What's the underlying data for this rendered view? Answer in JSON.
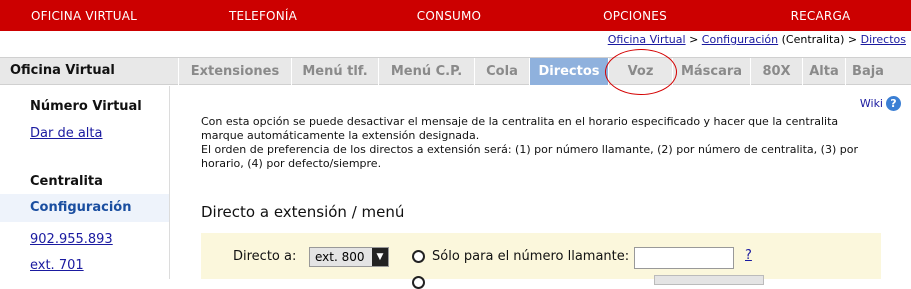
{
  "topnav": {
    "items": [
      {
        "label": "OFICINA VIRTUAL"
      },
      {
        "label": "TELEFONÍA"
      },
      {
        "label": "CONSUMO"
      },
      {
        "label": "OPCIONES"
      },
      {
        "label": "RECARGA"
      }
    ],
    "color": "#cc0000"
  },
  "breadcrumb": {
    "link1": "Oficina Virtual",
    "sep1": " > ",
    "link2": "Configuración",
    "plain": " (Centralita) > ",
    "link3": "Directos"
  },
  "tabrow": {
    "title": "Oficina Virtual",
    "tabs": [
      {
        "label": "Extensiones"
      },
      {
        "label": "Menú tlf."
      },
      {
        "label": "Menú C.P."
      },
      {
        "label": "Cola"
      },
      {
        "label": "Directos"
      },
      {
        "label": "Voz"
      },
      {
        "label": "Máscara"
      },
      {
        "label": "80X"
      },
      {
        "label": "Alta"
      },
      {
        "label": "Baja"
      }
    ],
    "active_tab": "Directos",
    "active_color": "#8fb1dd"
  },
  "sidebar": {
    "heading1": "Número Virtual",
    "link_alta": "Dar de alta",
    "heading2": "Centralita",
    "active_item": "Configuración",
    "link_number": "902.955.893",
    "link_ext": "ext. 701"
  },
  "main": {
    "wiki_label": "Wiki",
    "help_icon": "question-circle-icon",
    "description_line1": "Con esta opción se puede desactivar el mensaje de la centralita en el horario especificado y hacer que la centralita",
    "description_line2": "marque automáticamente la extensión designada.",
    "description_line3": "El orden de preferencia de los directos a extensión será: (1) por número llamante, (2) por número de centralita, (3) por",
    "description_line4": "horario, (4) por defecto/siempre.",
    "section_title": "Directo a extensión / menú",
    "directo_label": "Directo a:",
    "select_value": "ext. 800",
    "radio_label": "Sólo para el número llamante:",
    "input_value": "",
    "help_link": "?"
  }
}
